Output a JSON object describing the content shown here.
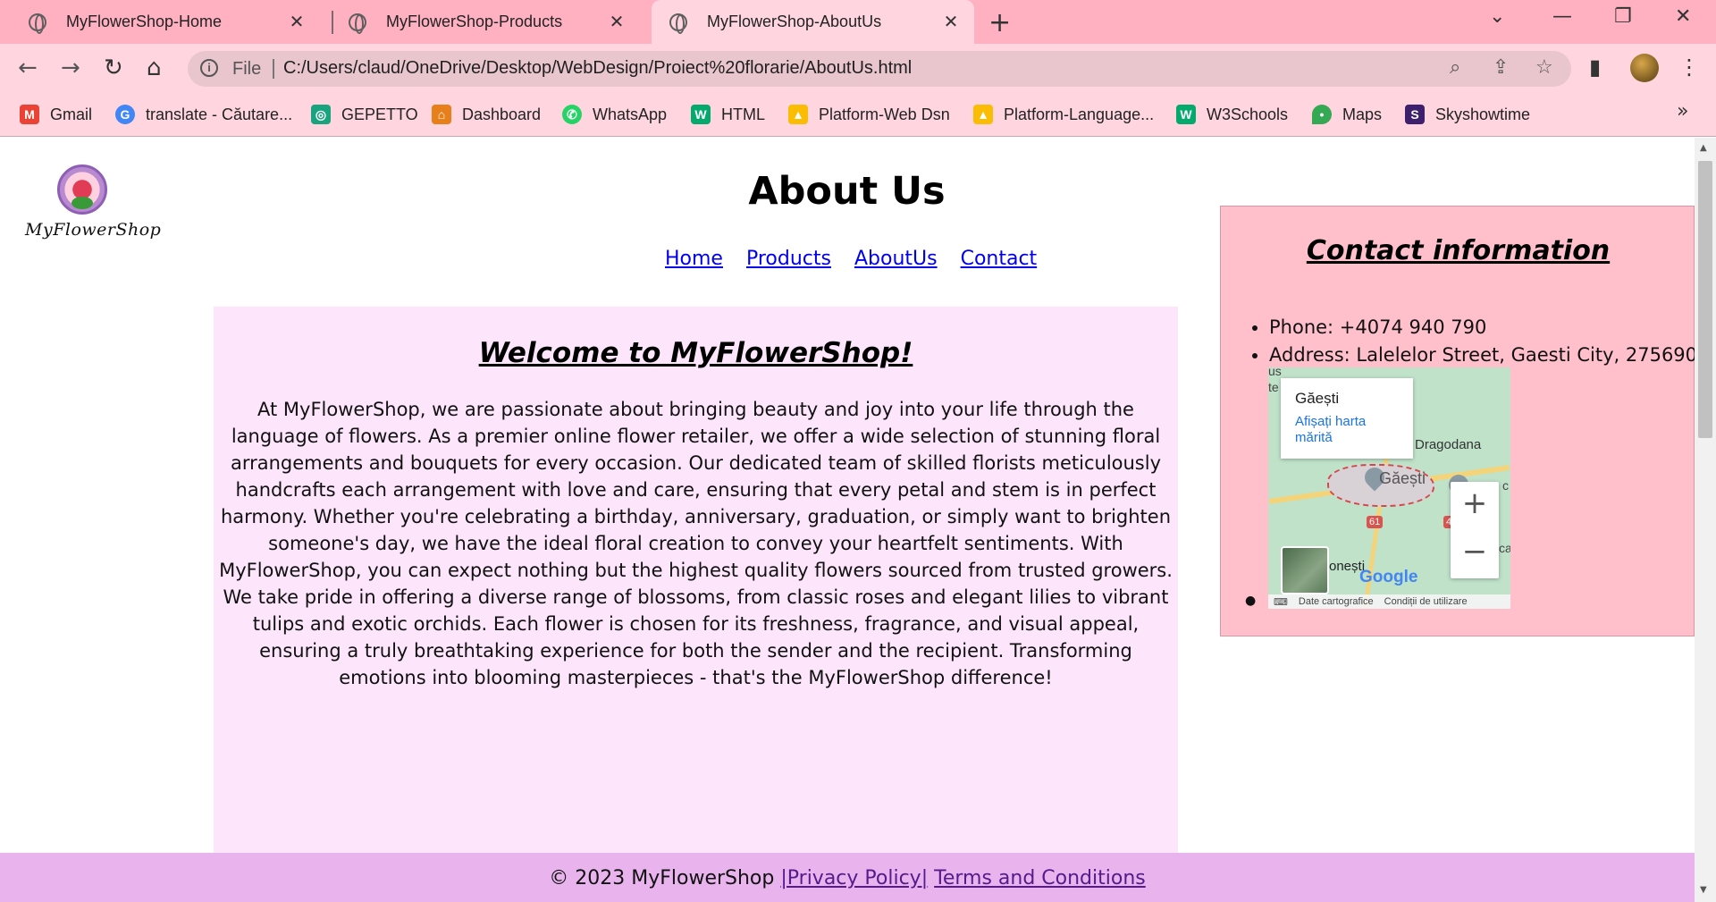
{
  "browser": {
    "tabs": [
      {
        "title": "MyFlowerShop-Home",
        "active": false
      },
      {
        "title": "MyFlowerShop-Products",
        "active": false
      },
      {
        "title": "MyFlowerShop-AboutUs",
        "active": true
      }
    ],
    "new_tab_icon": "plus-icon",
    "address": {
      "scheme_label": "File",
      "url": "C:/Users/claud/OneDrive/Desktop/WebDesign/Proiect%20florarie/AboutUs.html"
    },
    "bookmarks": [
      {
        "label": "Gmail",
        "icon": "gmail-icon",
        "color": "#ea4335"
      },
      {
        "label": "translate - Căutare...",
        "icon": "google-icon",
        "color": "#4285f4"
      },
      {
        "label": "GEPETTO",
        "icon": "chatgpt-icon",
        "color": "#19a37f"
      },
      {
        "label": "Dashboard",
        "icon": "dashboard-icon",
        "color": "#e77f1a"
      },
      {
        "label": "WhatsApp",
        "icon": "whatsapp-icon",
        "color": "#25d366"
      },
      {
        "label": "HTML",
        "icon": "w3schools-icon",
        "color": "#04aa6d"
      },
      {
        "label": "Platform-Web Dsn",
        "icon": "google-drive-icon",
        "color": "#fbbc04"
      },
      {
        "label": "Platform-Language...",
        "icon": "google-drive-icon",
        "color": "#fbbc04"
      },
      {
        "label": "W3Schools",
        "icon": "w3schools-icon",
        "color": "#04aa6d"
      },
      {
        "label": "Maps",
        "icon": "maps-icon",
        "color": "#34a853"
      },
      {
        "label": "Skyshowtime",
        "icon": "skyshowtime-icon",
        "color": "#3d1f6d"
      }
    ],
    "colors": {
      "tabbar": "#ffb0c1",
      "toolbar": "#ffd6e0"
    }
  },
  "page": {
    "logo_text": "MyFlowerShop",
    "title": "About Us",
    "nav": [
      "Home",
      "Products",
      "AboutUs",
      "Contact"
    ],
    "welcome": {
      "title": "Welcome to MyFlowerShop!",
      "text": "At MyFlowerShop, we are passionate about bringing beauty and joy into your life through the language of flowers. As a premier online flower retailer, we offer a wide selection of stunning floral arrangements and bouquets for every occasion. Our dedicated team of skilled florists meticulously handcrafts each arrangement with love and care, ensuring that every petal and stem is in perfect harmony. Whether you're celebrating a birthday, anniversary, graduation, or simply want to brighten someone's day, we have the ideal floral creation to convey your heartfelt sentiments. With MyFlowerShop, you can expect nothing but the highest quality flowers sourced from trusted growers. We take pride in offering a diverse range of blossoms, from classic roses and elegant lilies to vibrant tulips and exotic orchids. Each flower is chosen for its freshness, fragrance, and visual appeal, ensuring a truly breathtaking experience for both the sender and the recipient. Transforming emotions into blooming masterpieces - that's the MyFlowerShop difference!"
    },
    "contact": {
      "title": "Contact information",
      "phone": "Phone: +4074 940 790",
      "address": "Address: Lalelelor Street, Gaesti City, 275690"
    },
    "map": {
      "place": "Găești",
      "enlarge_link": "Afișați harta mărită",
      "label_town": "Găești",
      "label_nearby": "Dragodana",
      "label_south": "onești",
      "road_number": "61",
      "road_number_2": "40",
      "edge_left_1": "us",
      "edge_left_2": "te",
      "edge_right_1": "c",
      "edge_right_2": "ca",
      "zoom_in": "+",
      "zoom_out": "−",
      "logo": "Google",
      "attribution_data": "Date cartografice",
      "attribution_terms": "Condiții de utilizare"
    },
    "footer": {
      "copyright": "© 2023 MyFlowerShop ",
      "privacy": "|Privacy Policy|",
      "terms": "Terms and Conditions"
    },
    "colors": {
      "welcome_bg": "#fde6fb",
      "contact_bg": "#ffbfcb",
      "footer_bg": "#e9b4ed",
      "link": "#0000ee"
    }
  }
}
